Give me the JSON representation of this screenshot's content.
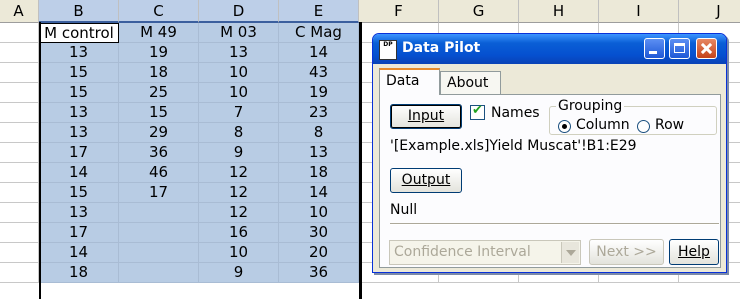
{
  "sheet": {
    "columns": [
      "A",
      "B",
      "C",
      "D",
      "E",
      "F",
      "G",
      "H",
      "I",
      "J"
    ],
    "headers": [
      "M control",
      "M 49",
      "M 03",
      "C Mag"
    ],
    "rows": [
      [
        "13",
        "19",
        "13",
        "14"
      ],
      [
        "15",
        "18",
        "10",
        "43"
      ],
      [
        "15",
        "25",
        "10",
        "19"
      ],
      [
        "13",
        "15",
        "7",
        "23"
      ],
      [
        "13",
        "29",
        "8",
        "8"
      ],
      [
        "17",
        "36",
        "9",
        "13"
      ],
      [
        "14",
        "46",
        "12",
        "18"
      ],
      [
        "15",
        "17",
        "12",
        "14"
      ],
      [
        "13",
        "",
        "12",
        "10"
      ],
      [
        "17",
        "",
        "16",
        "30"
      ],
      [
        "14",
        "",
        "10",
        "20"
      ],
      [
        "18",
        "",
        "9",
        "36"
      ]
    ],
    "selection_color": "#b8cce4"
  },
  "dialog": {
    "title": "Data Pilot",
    "icon_text": "Data Pilot",
    "tabs": [
      "Data",
      "About"
    ],
    "input_button": "Input",
    "names_label": "Names",
    "names_checked": true,
    "grouping_label": "Grouping",
    "grouping_options": [
      "Column",
      "Row"
    ],
    "grouping_selected": "Column",
    "input_range": "'[Example.xls]Yield Muscat'!B1:E29",
    "output_button": "Output",
    "output_value": "Null",
    "analysis_select": "Confidence Interval",
    "next_button": "Next >>",
    "help_button": "Help",
    "titlebar_color": "#0a5fd6"
  }
}
